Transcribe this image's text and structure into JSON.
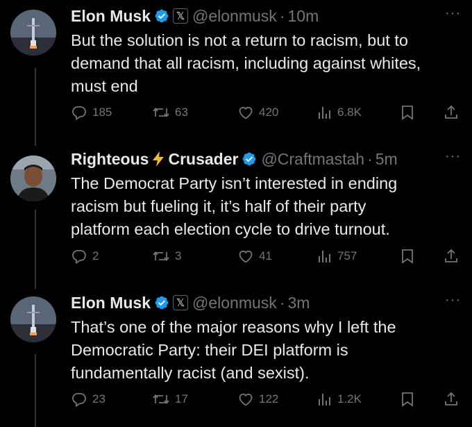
{
  "tweets": [
    {
      "name": "Elon Musk",
      "handle": "@elonmusk",
      "time": "10m",
      "badge": "𝕏",
      "text": "But the solution is not a return to racism, but to\ndemand that all racism, including against whites,\nmust end",
      "replies": "185",
      "reposts": "63",
      "likes": "420",
      "views": "6.8K"
    },
    {
      "name_part1": "Righteous",
      "name_part2": "Crusader",
      "handle": "@Craftmastah",
      "time": "5m",
      "text": "The Democrat Party isn’t interested in ending\nracism but fueling it, it’s half of their party\nplatform each election cycle to drive turnout.",
      "replies": "2",
      "reposts": "3",
      "likes": "41",
      "views": "757"
    },
    {
      "name": "Elon Musk",
      "handle": "@elonmusk",
      "time": "3m",
      "badge": "𝕏",
      "text": "That’s one of the major reasons why I left the\nDemocratic Party: their DEI platform is\nfundamentally racist (and sexist).",
      "replies": "23",
      "reposts": "17",
      "likes": "122",
      "views": "1.2K"
    }
  ],
  "separator": "·",
  "more_glyph": "···",
  "colors": {
    "background": "#000000",
    "text": "#e7e9ea",
    "muted": "#71767b",
    "verified": "#1d9bf0",
    "thread_line": "#333639"
  },
  "icons": [
    "reply-icon",
    "repost-icon",
    "like-icon",
    "views-icon",
    "bookmark-icon",
    "share-icon",
    "verified-icon",
    "lightning-icon",
    "more-icon"
  ]
}
